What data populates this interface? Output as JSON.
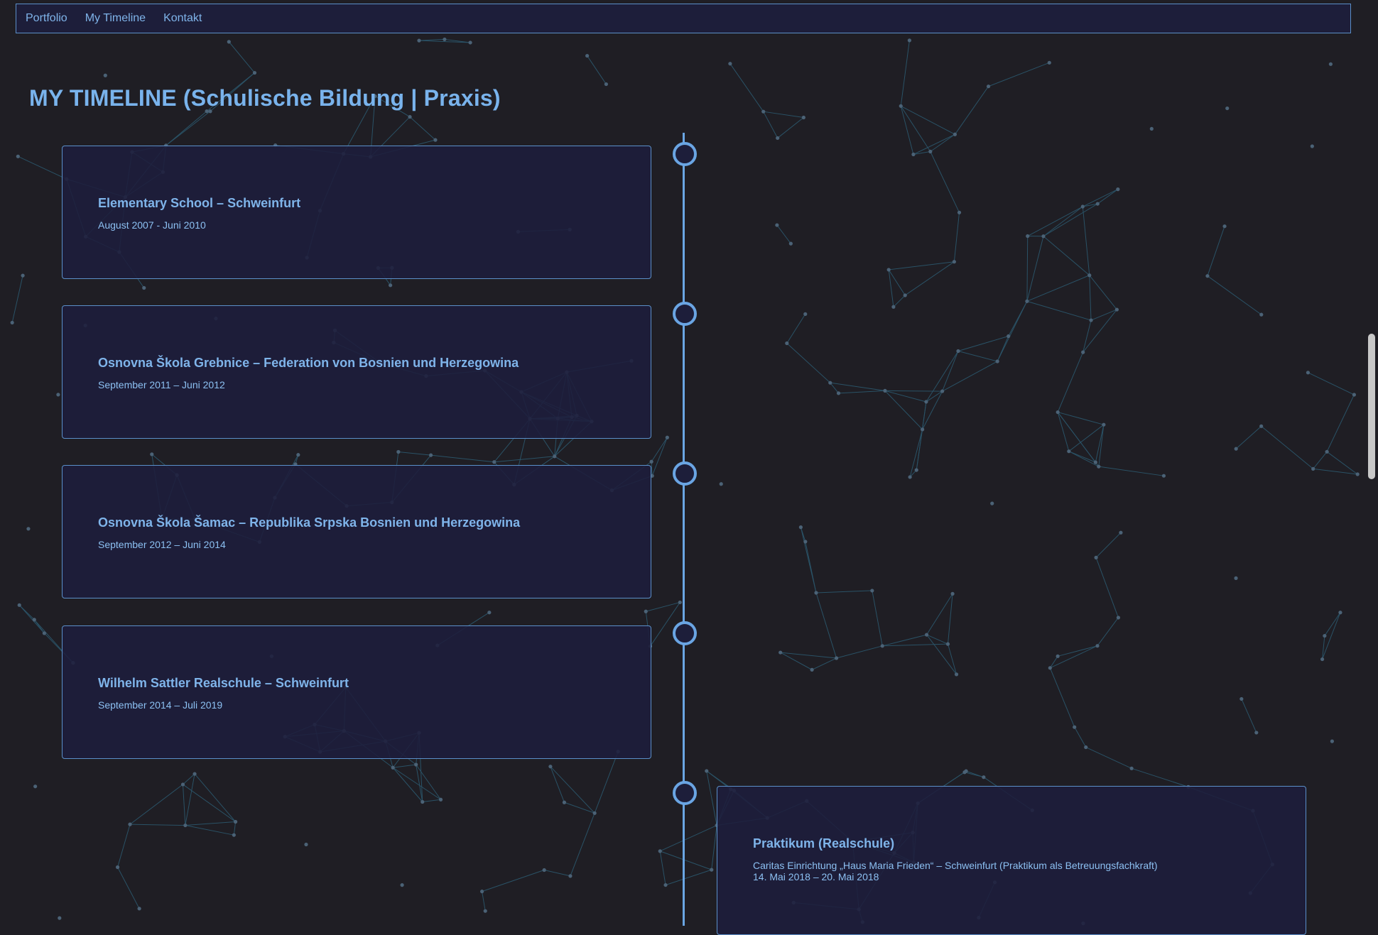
{
  "nav": {
    "items": [
      {
        "label": "Portfolio"
      },
      {
        "label": "My Timeline"
      },
      {
        "label": "Kontakt"
      }
    ]
  },
  "page": {
    "title": "MY TIMELINE (Schulische Bildung | Praxis)"
  },
  "timeline": [
    {
      "title": "Elementary School – Schweinfurt",
      "lines": [
        "August 2007 - Juni 2010"
      ]
    },
    {
      "title": "Osnovna Škola Grebnice – Federation von Bosnien und Herzegowina",
      "lines": [
        "September 2011 – Juni 2012"
      ]
    },
    {
      "title": "Osnovna Škola Šamac – Republika Srpska Bosnien und Herzegowina",
      "lines": [
        "September 2012 – Juni 2014"
      ]
    },
    {
      "title": "Wilhelm Sattler Realschule – Schweinfurt",
      "lines": [
        "September 2014 – Juli 2019"
      ]
    },
    {
      "title": "Praktikum (Realschule)",
      "lines": [
        "Caritas Einrichtung „Haus Maria Frieden“ – Schweinfurt (Praktikum als Betreuungsfachkraft)",
        "14. Mai 2018 – 20. Mai 2018"
      ]
    }
  ],
  "colors": {
    "background": "#1f1e24",
    "accent": "#79b3ec",
    "card_background": "#1d1e3a",
    "card_border": "#5b8fc9",
    "timeline": "#6aa5e3"
  }
}
